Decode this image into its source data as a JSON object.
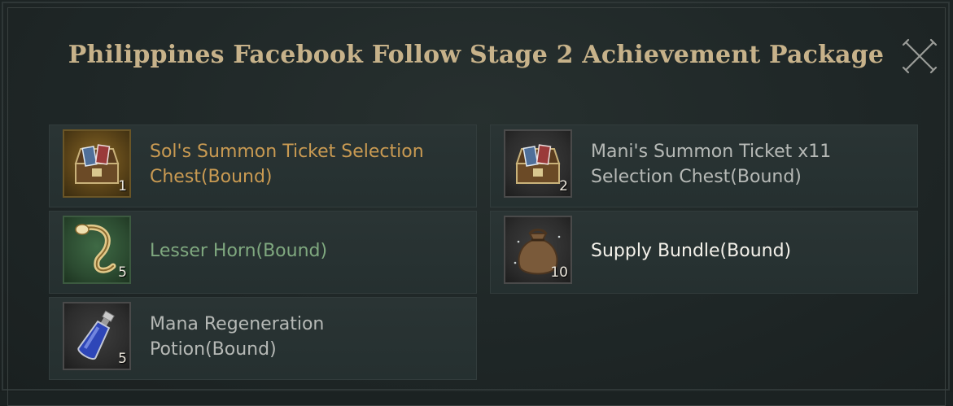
{
  "dialog": {
    "title": "Philippines Facebook Follow Stage 2 Achievement Package",
    "close_icon": "close-x-icon"
  },
  "items": [
    {
      "name_line1": "Sol's Summon Ticket Selection",
      "name_line2": "Chest(Bound)",
      "quantity": "1",
      "rarity": "gold",
      "name_color": "#c99a52",
      "icon": "treasure-chest-icon"
    },
    {
      "name_line1": "Mani's Summon Ticket x11",
      "name_line2": "Selection Chest(Bound)",
      "quantity": "2",
      "rarity": "grey",
      "name_color": "#b6b9b6",
      "icon": "treasure-chest-icon"
    },
    {
      "name_line1": "Lesser Horn(Bound)",
      "name_line2": "",
      "quantity": "5",
      "rarity": "green",
      "name_color": "#7fa87f",
      "icon": "horn-icon"
    },
    {
      "name_line1": "Supply Bundle(Bound)",
      "name_line2": "",
      "quantity": "10",
      "rarity": "white",
      "name_color": "#f4f1ea",
      "icon": "sack-icon"
    },
    {
      "name_line1": "Mana Regeneration",
      "name_line2": "Potion(Bound)",
      "quantity": "5",
      "rarity": "grey",
      "name_color": "#b6b9b6",
      "icon": "potion-icon"
    }
  ]
}
